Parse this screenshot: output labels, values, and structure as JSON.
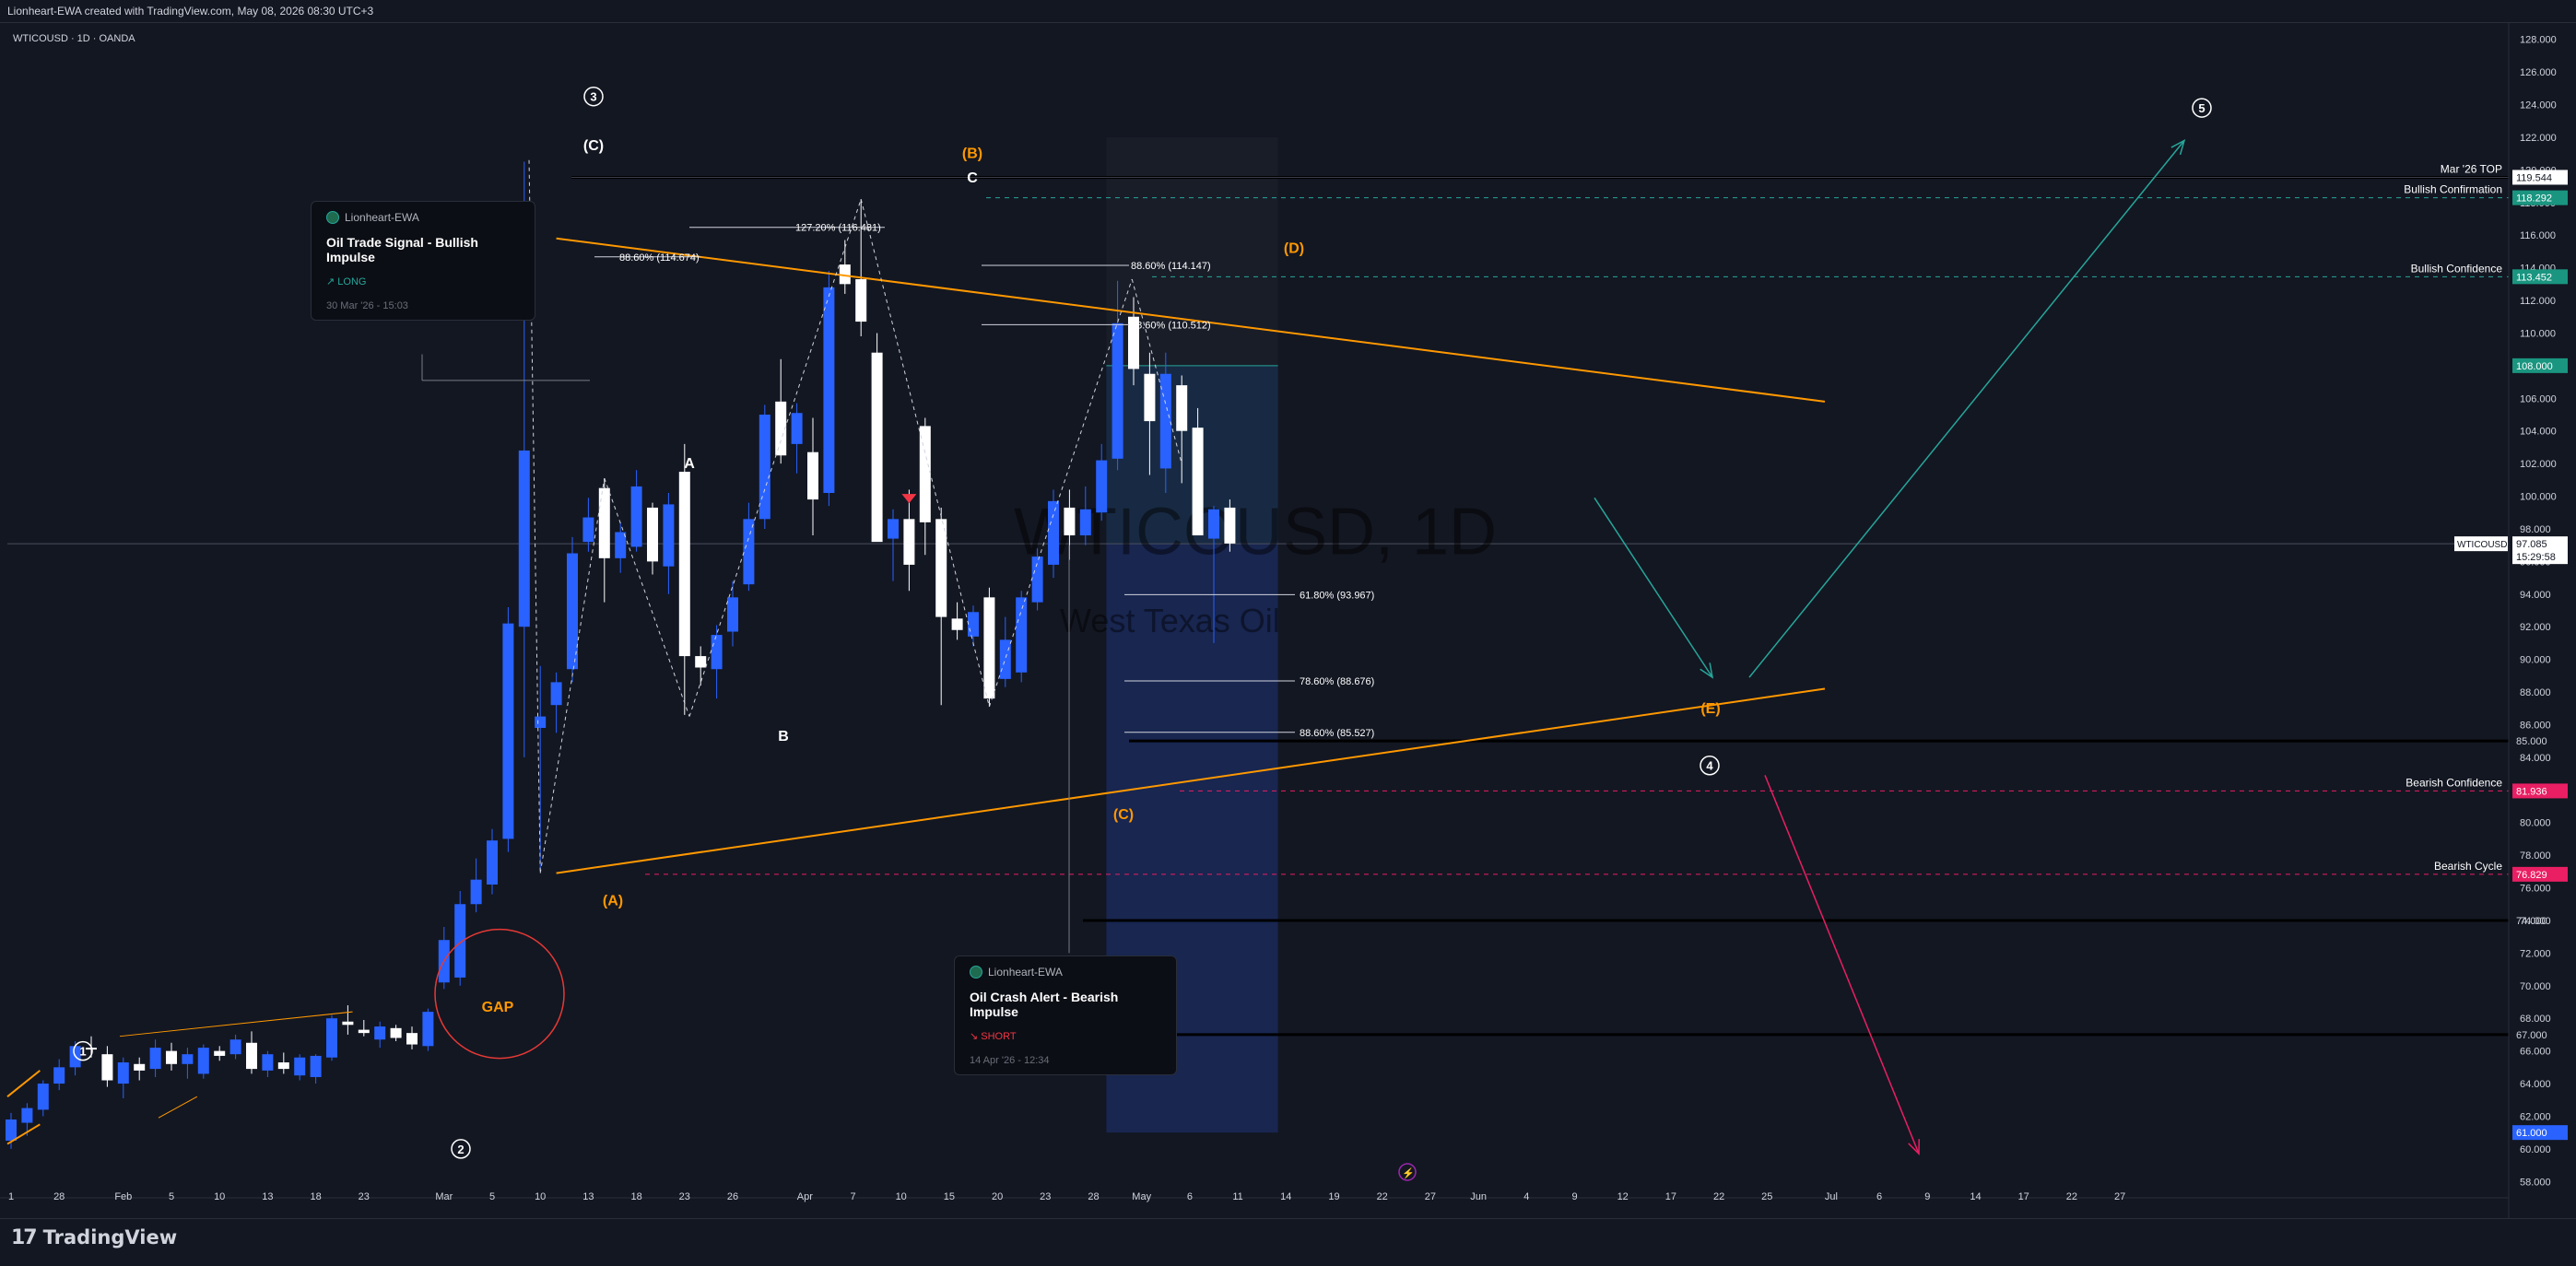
{
  "header": {
    "text": "Lionheart-EWA created with TradingView.com, May 08, 2026 08:30 UTC+3"
  },
  "symbol_line": "WTICOUSD · 1D · OANDA",
  "watermark": {
    "symbol": "WTICOUSD, 1D",
    "name": "West Texas Oil"
  },
  "brand": {
    "logo_mark": "17",
    "name": "TradingView"
  },
  "colors": {
    "bull": "#2962ff",
    "bear": "#ffffff",
    "wave": "#ff9800",
    "teal": "#26a69a",
    "red": "#e91e63",
    "bg": "#131722"
  },
  "cards": [
    {
      "author": "Lionheart-EWA",
      "title": "Oil Trade Signal - Bullish Impulse",
      "tag": "↗ LONG",
      "date": "30 Mar '26 - 15:03"
    },
    {
      "author": "Lionheart-EWA",
      "title": "Oil Crash Alert - Bearish Impulse",
      "tag": "↘ SHORT",
      "date": "14 Apr '26 - 12:34"
    }
  ],
  "chart_data": {
    "type": "candlestick",
    "symbol": "WTICOUSD",
    "interval": "1D",
    "ylim": [
      57,
      129
    ],
    "y_ticks": [
      58,
      60,
      62,
      64,
      66,
      68,
      70,
      72,
      74,
      76,
      78,
      80,
      82,
      84,
      86,
      88,
      90,
      92,
      94,
      96,
      98,
      100,
      102,
      104,
      106,
      108,
      110,
      112,
      114,
      116,
      118,
      120,
      122,
      124,
      126,
      128
    ],
    "x_ticks": [
      {
        "label": "1",
        "t": 0
      },
      {
        "label": "28",
        "t": 3
      },
      {
        "label": "Feb",
        "t": 7
      },
      {
        "label": "5",
        "t": 10
      },
      {
        "label": "10",
        "t": 13
      },
      {
        "label": "13",
        "t": 16
      },
      {
        "label": "18",
        "t": 19
      },
      {
        "label": "23",
        "t": 22
      },
      {
        "label": "Mar",
        "t": 27
      },
      {
        "label": "5",
        "t": 30
      },
      {
        "label": "10",
        "t": 33
      },
      {
        "label": "13",
        "t": 36
      },
      {
        "label": "18",
        "t": 39
      },
      {
        "label": "23",
        "t": 42
      },
      {
        "label": "26",
        "t": 45
      },
      {
        "label": "Apr",
        "t": 49.5
      },
      {
        "label": "7",
        "t": 52.5
      },
      {
        "label": "10",
        "t": 55.5
      },
      {
        "label": "15",
        "t": 58.5
      },
      {
        "label": "20",
        "t": 61.5
      },
      {
        "label": "23",
        "t": 64.5
      },
      {
        "label": "28",
        "t": 67.5
      },
      {
        "label": "May",
        "t": 70.5
      },
      {
        "label": "6",
        "t": 73.5
      },
      {
        "label": "11",
        "t": 76.5
      },
      {
        "label": "14",
        "t": 79.5
      },
      {
        "label": "19",
        "t": 82.5
      },
      {
        "label": "22",
        "t": 85.5
      },
      {
        "label": "27",
        "t": 88.5
      },
      {
        "label": "Jun",
        "t": 91.5
      },
      {
        "label": "4",
        "t": 94.5
      },
      {
        "label": "9",
        "t": 97.5
      },
      {
        "label": "12",
        "t": 100.5
      },
      {
        "label": "17",
        "t": 103.5
      },
      {
        "label": "22",
        "t": 106.5
      },
      {
        "label": "25",
        "t": 109.5
      },
      {
        "label": "Jul",
        "t": 113.5
      },
      {
        "label": "6",
        "t": 116.5
      },
      {
        "label": "9",
        "t": 119.5
      },
      {
        "label": "14",
        "t": 122.5
      },
      {
        "label": "17",
        "t": 125.5
      },
      {
        "label": "22",
        "t": 128.5
      },
      {
        "label": "27",
        "t": 131.5
      }
    ],
    "candles": [
      {
        "t": 0,
        "o": 60.5,
        "h": 62.2,
        "l": 60.0,
        "c": 61.8
      },
      {
        "t": 1,
        "o": 61.6,
        "h": 62.8,
        "l": 60.8,
        "c": 62.5
      },
      {
        "t": 2,
        "o": 62.4,
        "h": 64.2,
        "l": 62.0,
        "c": 64.0
      },
      {
        "t": 3,
        "o": 64.0,
        "h": 65.5,
        "l": 63.6,
        "c": 65.0
      },
      {
        "t": 4,
        "o": 65.0,
        "h": 66.6,
        "l": 64.5,
        "c": 66.3
      },
      {
        "t": 5,
        "o": 66.2,
        "h": 66.9,
        "l": 65.6,
        "c": 66.1
      },
      {
        "t": 6,
        "o": 65.8,
        "h": 66.3,
        "l": 63.8,
        "c": 64.2
      },
      {
        "t": 7,
        "o": 64.0,
        "h": 65.6,
        "l": 63.1,
        "c": 65.3
      },
      {
        "t": 8,
        "o": 65.2,
        "h": 65.6,
        "l": 64.2,
        "c": 64.8
      },
      {
        "t": 9,
        "o": 64.9,
        "h": 66.7,
        "l": 64.4,
        "c": 66.2
      },
      {
        "t": 10,
        "o": 66.0,
        "h": 66.5,
        "l": 64.8,
        "c": 65.2
      },
      {
        "t": 11,
        "o": 65.2,
        "h": 66.2,
        "l": 64.3,
        "c": 65.8
      },
      {
        "t": 12,
        "o": 64.6,
        "h": 66.4,
        "l": 64.3,
        "c": 66.2
      },
      {
        "t": 13,
        "o": 66.0,
        "h": 66.3,
        "l": 65.4,
        "c": 65.7
      },
      {
        "t": 14,
        "o": 65.8,
        "h": 67.0,
        "l": 65.5,
        "c": 66.7
      },
      {
        "t": 15,
        "o": 66.5,
        "h": 67.2,
        "l": 64.6,
        "c": 64.9
      },
      {
        "t": 16,
        "o": 64.8,
        "h": 66.0,
        "l": 64.4,
        "c": 65.8
      },
      {
        "t": 17,
        "o": 65.3,
        "h": 65.9,
        "l": 64.6,
        "c": 64.9
      },
      {
        "t": 18,
        "o": 64.5,
        "h": 65.8,
        "l": 64.2,
        "c": 65.6
      },
      {
        "t": 19,
        "o": 64.4,
        "h": 65.8,
        "l": 64.0,
        "c": 65.7
      },
      {
        "t": 20,
        "o": 65.6,
        "h": 68.2,
        "l": 65.4,
        "c": 68.0
      },
      {
        "t": 21,
        "o": 67.8,
        "h": 68.8,
        "l": 67.0,
        "c": 67.6
      },
      {
        "t": 22,
        "o": 67.3,
        "h": 67.9,
        "l": 66.9,
        "c": 67.1
      },
      {
        "t": 23,
        "o": 66.7,
        "h": 67.8,
        "l": 66.2,
        "c": 67.5
      },
      {
        "t": 24,
        "o": 67.4,
        "h": 67.6,
        "l": 66.6,
        "c": 66.8
      },
      {
        "t": 25,
        "o": 67.1,
        "h": 67.5,
        "l": 66.1,
        "c": 66.4
      },
      {
        "t": 26,
        "o": 66.3,
        "h": 68.6,
        "l": 66.0,
        "c": 68.4
      },
      {
        "t": 27,
        "o": 70.2,
        "h": 73.6,
        "l": 69.8,
        "c": 72.8
      },
      {
        "t": 28,
        "o": 70.5,
        "h": 75.8,
        "l": 70.0,
        "c": 75.0
      },
      {
        "t": 29,
        "o": 75.0,
        "h": 77.8,
        "l": 74.5,
        "c": 76.5
      },
      {
        "t": 30,
        "o": 76.2,
        "h": 79.6,
        "l": 75.6,
        "c": 78.9
      },
      {
        "t": 31,
        "o": 79.0,
        "h": 93.2,
        "l": 78.2,
        "c": 92.2
      },
      {
        "t": 32,
        "o": 92.0,
        "h": 120.5,
        "l": 84.0,
        "c": 102.8
      },
      {
        "t": 33,
        "o": 85.8,
        "h": 89.6,
        "l": 77.0,
        "c": 86.5
      },
      {
        "t": 34,
        "o": 87.2,
        "h": 89.2,
        "l": 85.5,
        "c": 88.6
      },
      {
        "t": 35,
        "o": 89.4,
        "h": 97.5,
        "l": 88.6,
        "c": 96.5
      },
      {
        "t": 36,
        "o": 97.2,
        "h": 99.9,
        "l": 96.6,
        "c": 98.7
      },
      {
        "t": 37,
        "o": 100.5,
        "h": 101.1,
        "l": 93.5,
        "c": 96.2
      },
      {
        "t": 38,
        "o": 96.2,
        "h": 98.4,
        "l": 95.3,
        "c": 97.8
      },
      {
        "t": 39,
        "o": 96.9,
        "h": 101.6,
        "l": 96.6,
        "c": 100.6
      },
      {
        "t": 40,
        "o": 99.3,
        "h": 99.6,
        "l": 95.2,
        "c": 96.0
      },
      {
        "t": 41,
        "o": 95.7,
        "h": 100.2,
        "l": 94.0,
        "c": 99.5
      },
      {
        "t": 42,
        "o": 101.5,
        "h": 103.2,
        "l": 86.6,
        "c": 90.2
      },
      {
        "t": 43,
        "o": 90.2,
        "h": 90.8,
        "l": 88.4,
        "c": 89.5
      },
      {
        "t": 44,
        "o": 89.4,
        "h": 92.1,
        "l": 87.6,
        "c": 91.5
      },
      {
        "t": 45,
        "o": 91.7,
        "h": 94.8,
        "l": 90.8,
        "c": 93.8
      },
      {
        "t": 46,
        "o": 94.6,
        "h": 99.6,
        "l": 94.2,
        "c": 98.6
      },
      {
        "t": 47,
        "o": 98.6,
        "h": 105.6,
        "l": 98.0,
        "c": 105.0
      },
      {
        "t": 48,
        "o": 105.8,
        "h": 108.4,
        "l": 102.0,
        "c": 102.5
      },
      {
        "t": 49,
        "o": 103.2,
        "h": 105.7,
        "l": 101.4,
        "c": 105.1
      },
      {
        "t": 50,
        "o": 102.7,
        "h": 104.8,
        "l": 97.6,
        "c": 99.8
      },
      {
        "t": 51,
        "o": 100.2,
        "h": 113.8,
        "l": 99.4,
        "c": 112.8
      },
      {
        "t": 52,
        "o": 114.2,
        "h": 115.7,
        "l": 112.4,
        "c": 113.0
      },
      {
        "t": 53,
        "o": 113.3,
        "h": 118.2,
        "l": 109.8,
        "c": 110.7
      },
      {
        "t": 54,
        "o": 108.8,
        "h": 110.0,
        "l": 98.0,
        "c": 97.2
      },
      {
        "t": 55,
        "o": 97.4,
        "h": 99.2,
        "l": 94.8,
        "c": 98.6
      },
      {
        "t": 56,
        "o": 98.6,
        "h": 100.4,
        "l": 94.2,
        "c": 95.8
      },
      {
        "t": 57,
        "o": 104.3,
        "h": 104.8,
        "l": 96.4,
        "c": 98.4
      },
      {
        "t": 58,
        "o": 98.6,
        "h": 99.3,
        "l": 87.2,
        "c": 92.6
      },
      {
        "t": 59,
        "o": 92.5,
        "h": 93.5,
        "l": 91.2,
        "c": 91.8
      },
      {
        "t": 60,
        "o": 91.4,
        "h": 93.3,
        "l": 90.8,
        "c": 92.9
      },
      {
        "t": 61,
        "o": 93.8,
        "h": 94.4,
        "l": 87.1,
        "c": 87.6
      },
      {
        "t": 62,
        "o": 88.8,
        "h": 92.6,
        "l": 88.3,
        "c": 91.2
      },
      {
        "t": 63,
        "o": 89.2,
        "h": 94.2,
        "l": 88.6,
        "c": 93.8
      },
      {
        "t": 64,
        "o": 93.5,
        "h": 96.8,
        "l": 93.0,
        "c": 96.3
      },
      {
        "t": 65,
        "o": 95.8,
        "h": 100.4,
        "l": 95.0,
        "c": 99.7
      },
      {
        "t": 66,
        "o": 99.3,
        "h": 100.4,
        "l": 96.1,
        "c": 97.6
      },
      {
        "t": 67,
        "o": 97.6,
        "h": 100.6,
        "l": 97.0,
        "c": 99.2
      },
      {
        "t": 68,
        "o": 99.0,
        "h": 103.2,
        "l": 98.5,
        "c": 102.2
      },
      {
        "t": 69,
        "o": 102.3,
        "h": 113.2,
        "l": 101.6,
        "c": 110.6
      },
      {
        "t": 70,
        "o": 111.0,
        "h": 112.2,
        "l": 106.8,
        "c": 107.8
      },
      {
        "t": 71,
        "o": 107.5,
        "h": 108.8,
        "l": 101.3,
        "c": 104.6
      },
      {
        "t": 72,
        "o": 101.7,
        "h": 108.8,
        "l": 100.2,
        "c": 107.5
      },
      {
        "t": 73,
        "o": 106.8,
        "h": 107.4,
        "l": 100.8,
        "c": 104.0
      },
      {
        "t": 74,
        "o": 104.2,
        "h": 105.4,
        "l": 98.4,
        "c": 97.6
      },
      {
        "t": 75,
        "o": 97.4,
        "h": 99.4,
        "l": 91.0,
        "c": 99.2
      },
      {
        "t": 76,
        "o": 99.3,
        "h": 99.8,
        "l": 96.6,
        "c": 97.1
      }
    ],
    "last_price": {
      "symbol": "WTICOUSD",
      "value": "97.085",
      "countdown": "15:29:58"
    },
    "price_labels": [
      {
        "text": "119.544",
        "color": "#ffffff",
        "bg": "#ffffff",
        "fg": "#131722"
      },
      {
        "text": "118.292",
        "bg": "#1a9580",
        "fg": "#ffffff"
      },
      {
        "text": "113.452",
        "bg": "#1a9580",
        "fg": "#ffffff"
      },
      {
        "text": "108.000",
        "bg": "#1a9580",
        "fg": "#ffffff"
      },
      {
        "text": "85.000",
        "bg": "none",
        "fg": "#d1d4dc"
      },
      {
        "text": "81.936",
        "bg": "#e91e63",
        "fg": "#ffffff"
      },
      {
        "text": "76.829",
        "bg": "#e91e63",
        "fg": "#ffffff"
      },
      {
        "text": "74.000",
        "bg": "none",
        "fg": "#d1d4dc"
      },
      {
        "text": "67.000",
        "bg": "none",
        "fg": "#d1d4dc"
      },
      {
        "text": "61.000",
        "bg": "#2962ff",
        "fg": "#ffffff"
      }
    ],
    "levels": [
      {
        "label": "Mar '26 TOP",
        "value": 119.544
      },
      {
        "label": "Bullish Confirmation",
        "value": 118.292
      },
      {
        "label": "Bullish Confidence",
        "value": 113.452
      },
      {
        "label": "Bearish Confidence",
        "value": 81.936
      },
      {
        "label": "Bearish Cycle",
        "value": 76.829
      }
    ],
    "fib_labels": [
      {
        "text": "127.20% (116.481)"
      },
      {
        "text": "88.60% (114.674)"
      },
      {
        "text": "88.60% (114.147)"
      },
      {
        "text": "78.60% (110.512)"
      },
      {
        "text": "61.80% (93.967)"
      },
      {
        "text": "78.60% (88.676)"
      },
      {
        "text": "88.60% (85.527)"
      }
    ],
    "wave_labels": [
      {
        "text": "1"
      },
      {
        "text": "2"
      },
      {
        "text": "3"
      },
      {
        "text": "4"
      },
      {
        "text": "5"
      },
      {
        "text": "(C)"
      },
      {
        "text": "(A)"
      },
      {
        "text": "A"
      },
      {
        "text": "B"
      },
      {
        "text": "C"
      },
      {
        "text": "(B)"
      },
      {
        "text": "(C)"
      },
      {
        "text": "(D)"
      },
      {
        "text": "(E)"
      },
      {
        "text": "GAP"
      }
    ],
    "position_box": {
      "type": "long",
      "entry": 97.085,
      "target": 108.0,
      "stop": 61.0
    }
  }
}
